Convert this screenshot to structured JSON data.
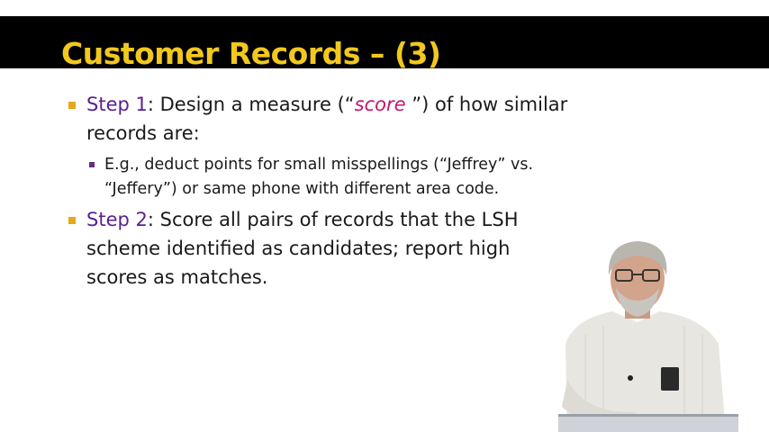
{
  "slide": {
    "title": "Customer Records – (3)"
  },
  "bullets": [
    {
      "step_label": "Step 1",
      "text_before": ": Design a measure (“",
      "emphasis": "score",
      "text_after": " ”) of how similar records are:",
      "sub_bullets": [
        "E.g., deduct points for small misspellings (“Jeffrey” vs. “Jeffery”) or same phone with different area code."
      ]
    },
    {
      "step_label": "Step 2",
      "text": ": Score all pairs of records that the LSH scheme identified as candidates; report high scores as matches."
    }
  ],
  "colors": {
    "title_bar": "#000000",
    "title_text": "#f2c81e",
    "step_label": "#5b1f8f",
    "emphasis": "#c2186e",
    "level1_marker": "#e6a817",
    "level2_marker": "#6a2a8c"
  }
}
